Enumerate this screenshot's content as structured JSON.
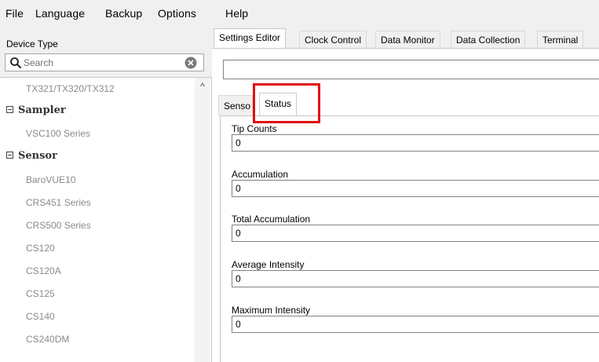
{
  "menu": [
    "File",
    "Language",
    "Backup",
    "Options",
    "Help"
  ],
  "left_panel": {
    "device_type_label": "Device Type",
    "search_placeholder": "Search",
    "tree": [
      {
        "kind": "leaf",
        "label": "TX321/TX320/TX312"
      },
      {
        "kind": "category",
        "label": "Sampler"
      },
      {
        "kind": "leaf",
        "label": "VSC100 Series"
      },
      {
        "kind": "category",
        "label": "Sensor"
      },
      {
        "kind": "leaf",
        "label": "BaroVUE10"
      },
      {
        "kind": "leaf",
        "label": "CRS451 Series"
      },
      {
        "kind": "leaf",
        "label": "CRS500 Series"
      },
      {
        "kind": "leaf",
        "label": "CS120"
      },
      {
        "kind": "leaf",
        "label": "CS120A"
      },
      {
        "kind": "leaf",
        "label": "CS125"
      },
      {
        "kind": "leaf",
        "label": "CS140"
      },
      {
        "kind": "leaf",
        "label": "CS240DM"
      }
    ]
  },
  "main_tabs": [
    "Settings Editor",
    "Clock Control",
    "Data Monitor",
    "Data Collection",
    "Terminal"
  ],
  "active_main_tab": "Settings Editor",
  "sub_tabs": [
    "Senso",
    "Status"
  ],
  "active_sub_tab": "Status",
  "path_field_value": "",
  "fields": [
    {
      "label": "Tip Counts",
      "value": "0"
    },
    {
      "label": "Accumulation",
      "value": "0"
    },
    {
      "label": "Total Accumulation",
      "value": "0"
    },
    {
      "label": "Average Intensity",
      "value": "0"
    },
    {
      "label": "Maximum Intensity",
      "value": "0"
    }
  ],
  "colors": {
    "highlight_border": "#e01010",
    "window_background": "#f0f0f0",
    "panel_background": "#ffffff"
  }
}
